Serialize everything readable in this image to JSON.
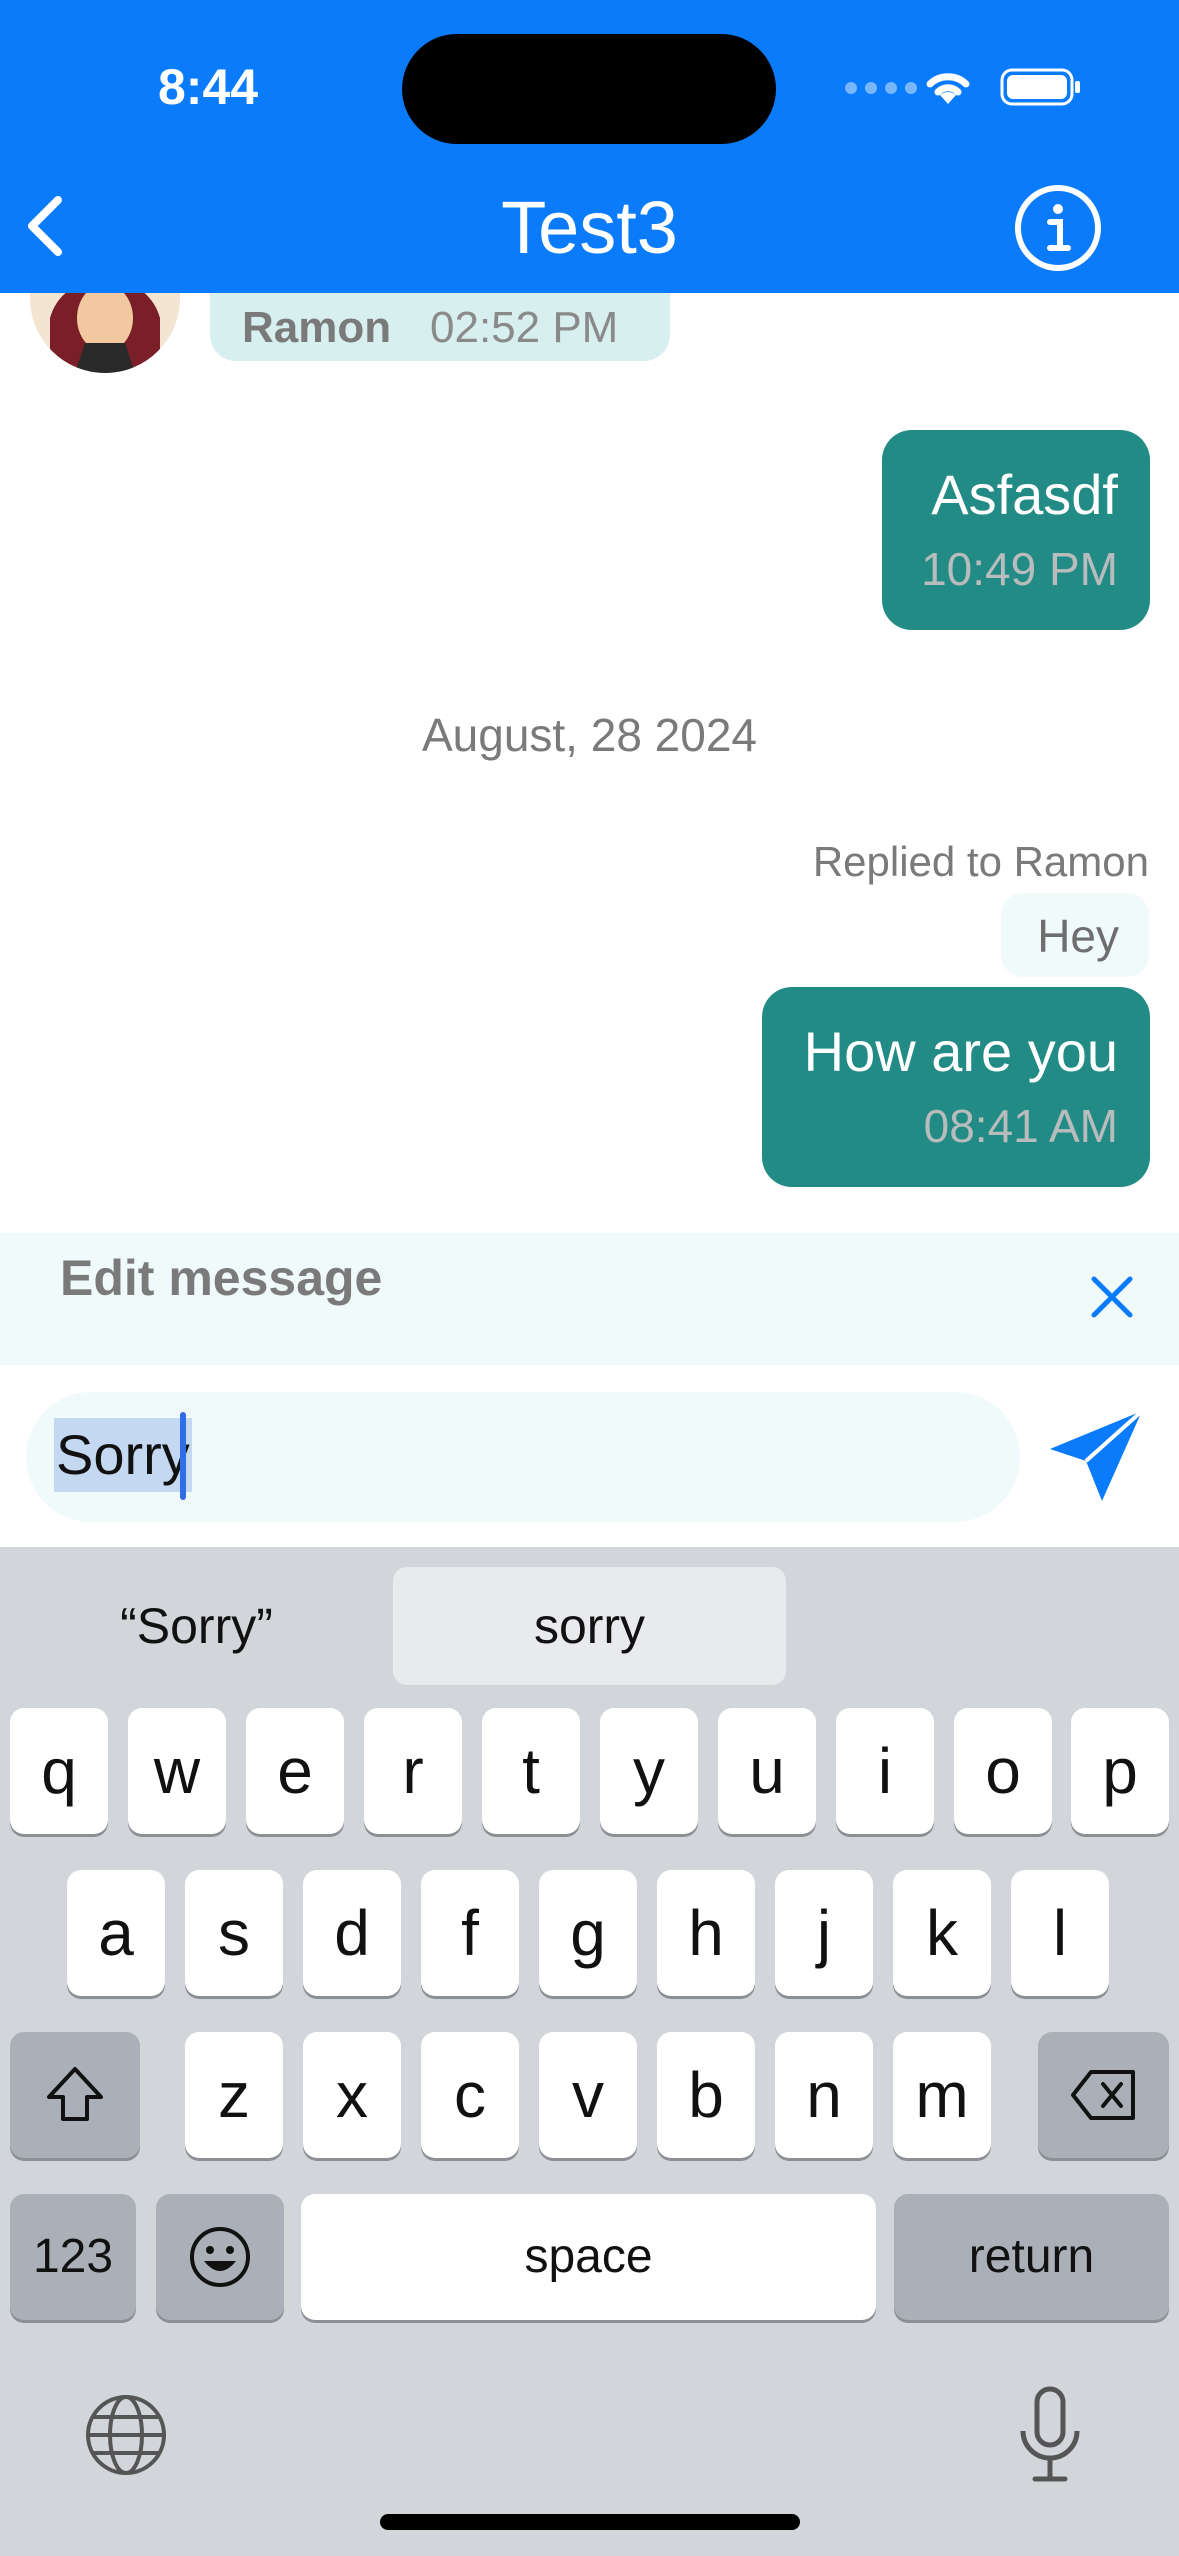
{
  "status_bar": {
    "time": "8:44"
  },
  "header": {
    "title": "Test3",
    "color": "#0a7cfb"
  },
  "messages": {
    "incoming": {
      "sender": "Ramon",
      "time": "02:52 PM"
    },
    "outgoing_1": {
      "text": "Asfasdf",
      "time": "10:49 PM"
    },
    "date_separator": "August, 28 2024",
    "reply": {
      "replied_to": "Replied to Ramon",
      "quoted": "Hey"
    },
    "outgoing_2": {
      "text": "How are you",
      "time": "08:41 AM"
    },
    "bubble_color": "#238b85"
  },
  "edit_bar": {
    "label": "Edit message"
  },
  "composer": {
    "value": "Sorry"
  },
  "keyboard": {
    "suggestions": [
      "“Sorry”",
      "sorry",
      ""
    ],
    "row1": [
      "q",
      "w",
      "e",
      "r",
      "t",
      "y",
      "u",
      "i",
      "o",
      "p"
    ],
    "row2": [
      "a",
      "s",
      "d",
      "f",
      "g",
      "h",
      "j",
      "k",
      "l"
    ],
    "row3": [
      "z",
      "x",
      "c",
      "v",
      "b",
      "n",
      "m"
    ],
    "numbers_key": "123",
    "space_key": "space",
    "return_key": "return"
  }
}
